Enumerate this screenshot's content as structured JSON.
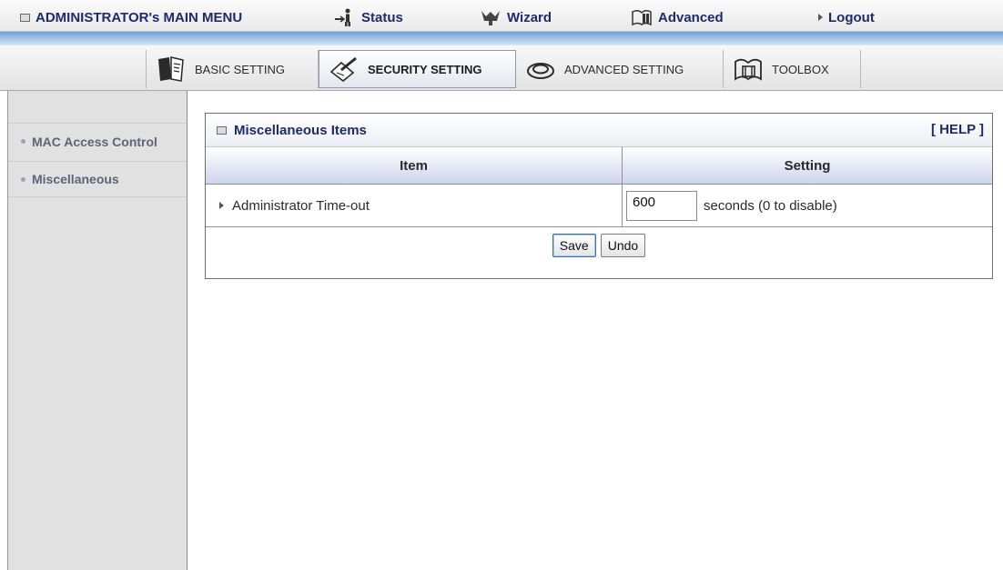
{
  "topbar": {
    "admin_menu": "ADMINISTRATOR's MAIN MENU",
    "status": "Status",
    "wizard": "Wizard",
    "advanced": "Advanced",
    "logout": "Logout"
  },
  "tabs": [
    {
      "label": "BASIC SETTING",
      "icon": "notebook-icon",
      "active": false
    },
    {
      "label": "SECURITY SETTING",
      "icon": "security-pen-icon",
      "active": true
    },
    {
      "label": "ADVANCED SETTING",
      "icon": "advanced-hat-icon",
      "active": false
    },
    {
      "label": "TOOLBOX",
      "icon": "toolbox-icon",
      "active": false
    }
  ],
  "sidebar": {
    "items": [
      {
        "label": "MAC Access Control"
      },
      {
        "label": "Miscellaneous"
      }
    ]
  },
  "panel": {
    "title": "Miscellaneous Items",
    "help": "[ HELP ]",
    "col_item": "Item",
    "col_setting": "Setting",
    "row": {
      "label": "Administrator Time-out",
      "value": "600",
      "suffix": "seconds (0 to disable)"
    },
    "save_label": "Save",
    "undo_label": "Undo"
  },
  "colors": {
    "title_text": "#1f2a6b",
    "sidebar_bg": "#e1e1e1",
    "header_band": "#6f9fd3"
  }
}
